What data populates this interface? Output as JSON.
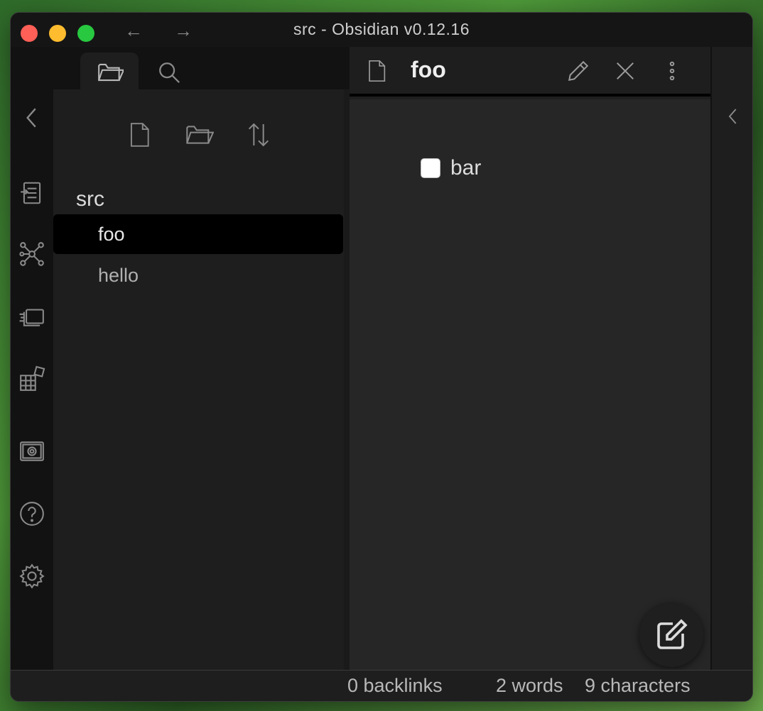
{
  "window": {
    "title": "src - Obsidian v0.12.16",
    "back_arrow": "←",
    "forward_arrow": "→"
  },
  "ribbon": {
    "items": [
      {
        "icon": "open-quick-switcher-icon"
      },
      {
        "icon": "graph-view-icon"
      },
      {
        "icon": "slides-icon"
      },
      {
        "icon": "community-plugins-icon"
      },
      {
        "icon": "open-vault-icon"
      },
      {
        "icon": "help-icon"
      },
      {
        "icon": "settings-icon"
      }
    ]
  },
  "sidebar": {
    "tabs": [
      {
        "icon": "folder-icon",
        "active": true
      },
      {
        "icon": "search-icon",
        "active": false
      }
    ],
    "explorer": {
      "actions": [
        {
          "icon": "new-note-icon"
        },
        {
          "icon": "new-folder-icon"
        },
        {
          "icon": "sort-icon"
        }
      ],
      "folder": "src",
      "files": [
        {
          "name": "foo",
          "active": true
        },
        {
          "name": "hello",
          "active": false
        }
      ]
    }
  },
  "editor": {
    "title": "foo",
    "tasks": [
      {
        "label": "bar",
        "checked": false
      }
    ]
  },
  "status": {
    "backlinks": "0 backlinks",
    "words": "2 words",
    "characters": "9 characters"
  },
  "colors": {
    "background": "#1e1e1e",
    "ribbon": "#121212",
    "active_file": "#000000",
    "editor": "#262626"
  }
}
